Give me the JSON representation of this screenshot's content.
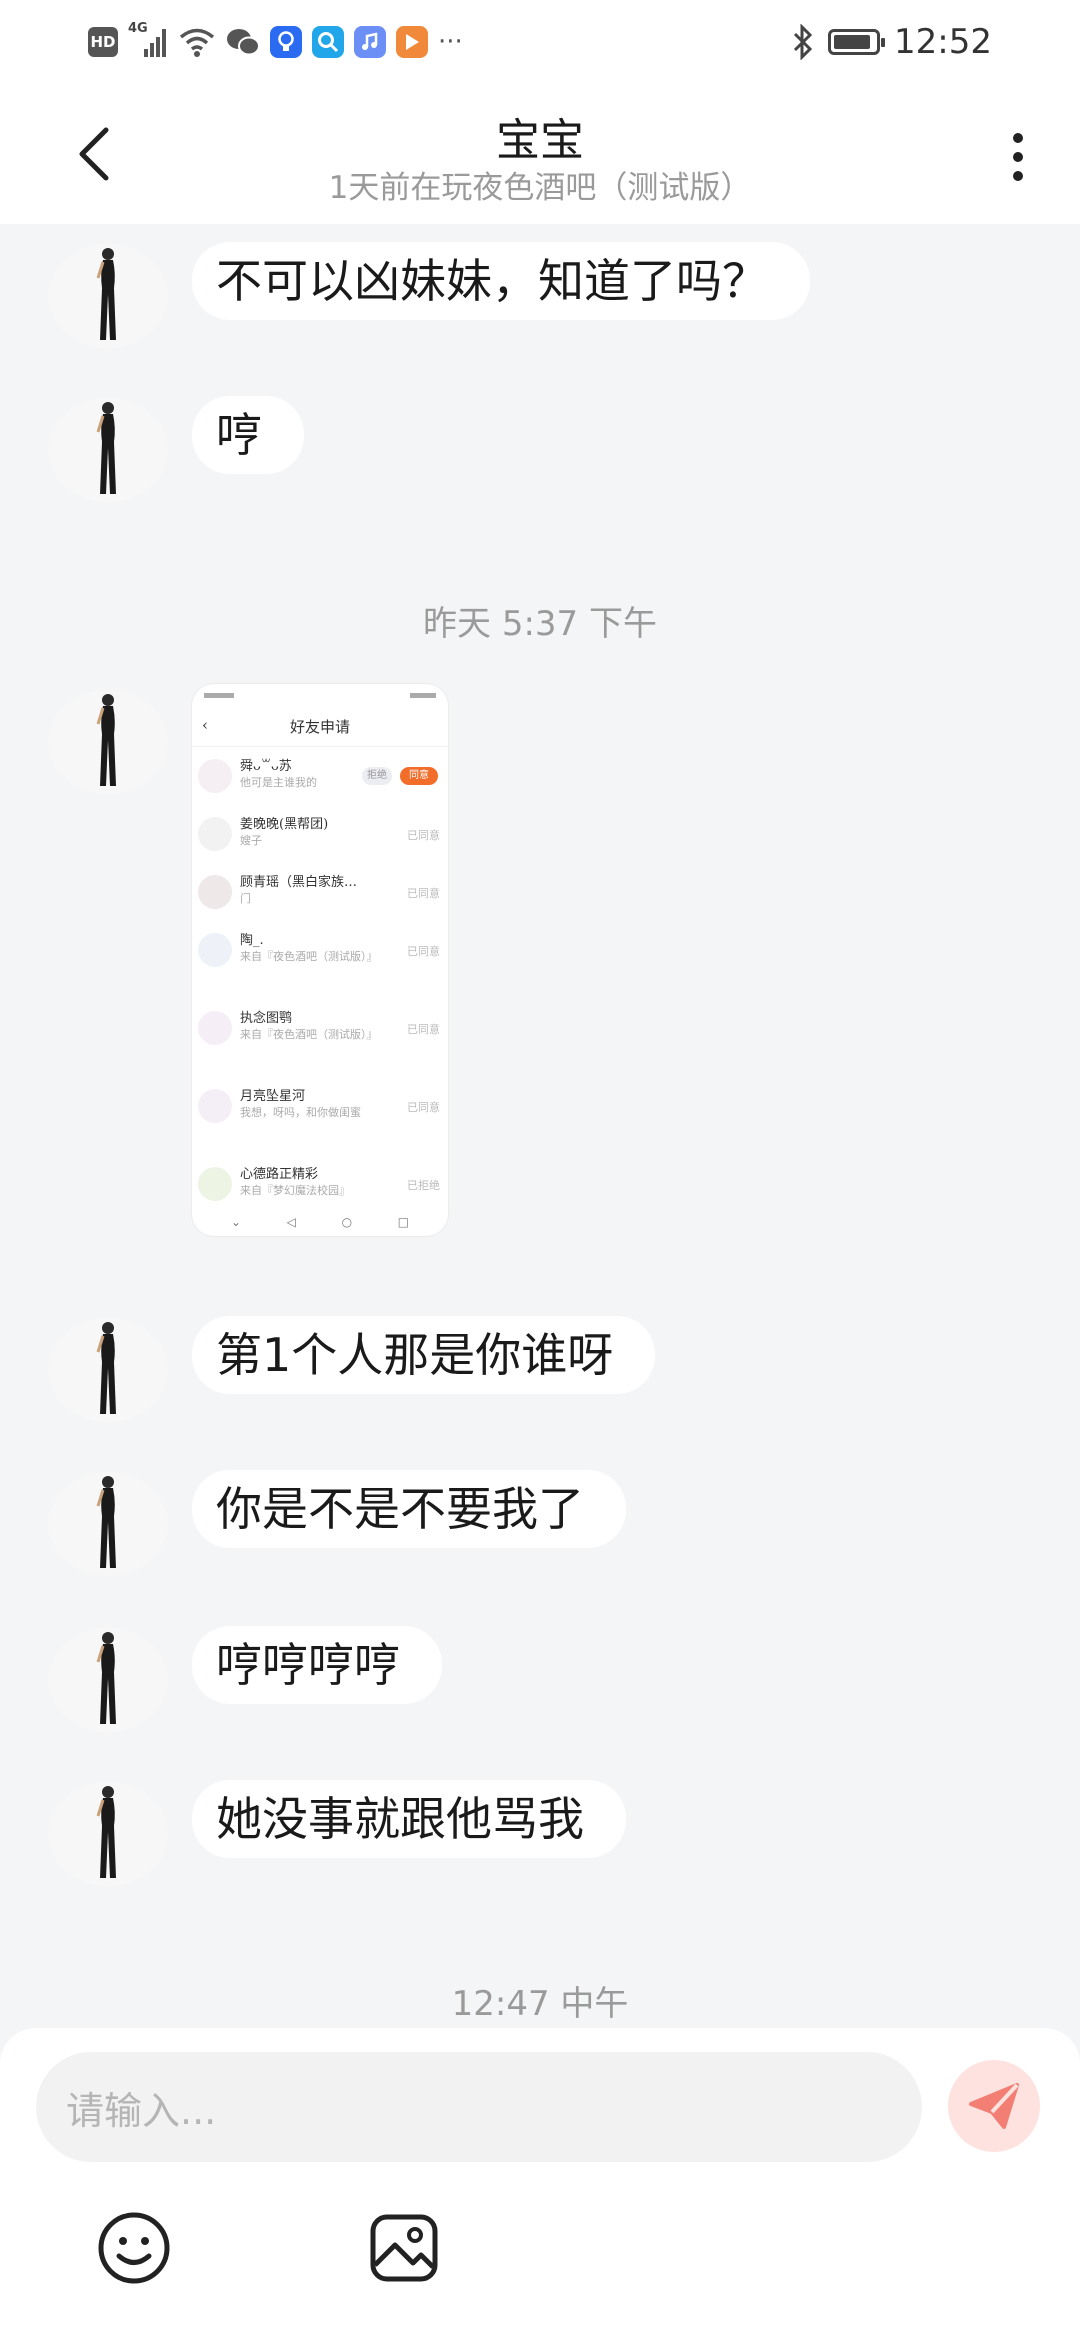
{
  "status_bar": {
    "hd_label": "HD",
    "network": "4G",
    "more": "···",
    "time": "12:52",
    "battery_level": 0.9
  },
  "header": {
    "title": "宝宝",
    "subtitle": "1天前在玩夜色酒吧（测试版）"
  },
  "messages": [
    {
      "type": "text",
      "text": "不可以凶妹妹，知道了吗？"
    },
    {
      "type": "text",
      "text": "哼"
    },
    {
      "type": "timestamp",
      "text": "昨天 5:37 下午"
    },
    {
      "type": "image",
      "screenshot": {
        "title": "好友申请",
        "rows": [
          {
            "name": "舜ᴗ꒳ᴗ苏",
            "sub": "他可是主谁我的",
            "state": "",
            "reject": "拒绝",
            "accept": "同意"
          },
          {
            "name": "姜晚晚(黑帮团)",
            "sub": "嫂子",
            "state": "已同意"
          },
          {
            "name": "顾青瑶（黑白家族…",
            "sub": "门",
            "state": "已同意"
          },
          {
            "name": "陶_.",
            "sub": "来自『夜色酒吧（测试版）』",
            "state": "已同意"
          },
          {
            "name": "执念图鹗",
            "sub": "来自『夜色酒吧（测试版）』",
            "state": "已同意"
          },
          {
            "name": "月亮坠星河",
            "sub": "我想，呀吗，和你做闺蜜",
            "state": "已同意"
          },
          {
            "name": "心德路正精彩",
            "sub": "来自『梦幻魔法校园』",
            "state": "已拒绝"
          }
        ]
      }
    },
    {
      "type": "text",
      "text": "第1个人那是你谁呀"
    },
    {
      "type": "text",
      "text": "你是不是不要我了"
    },
    {
      "type": "text",
      "text": "哼哼哼哼"
    },
    {
      "type": "text",
      "text": "她没事就跟他骂我"
    },
    {
      "type": "timestamp",
      "text": "12:47 中午"
    }
  ],
  "input": {
    "placeholder": "请输入...",
    "send_color": "#f37e73"
  },
  "toolbar": {
    "emoji": "smile-face-icon",
    "image": "image-picker-icon"
  }
}
